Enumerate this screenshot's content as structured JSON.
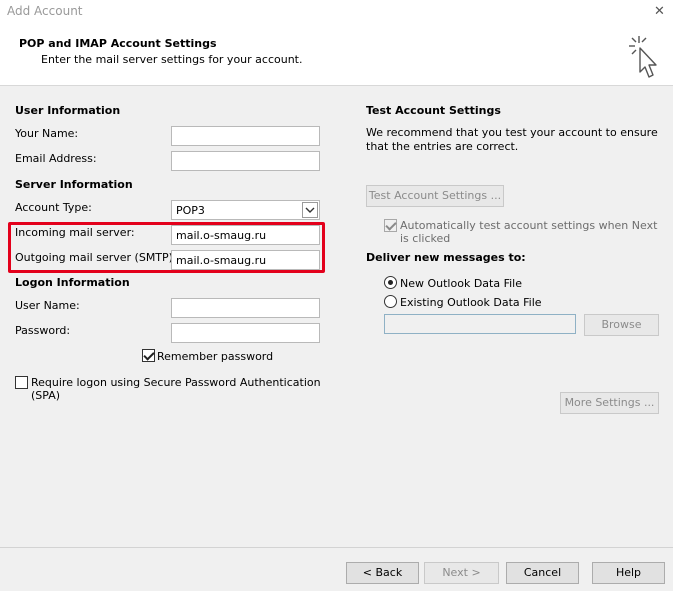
{
  "window": {
    "title": "Add Account",
    "close": "✕"
  },
  "header": {
    "title": "POP and IMAP Account Settings",
    "subtitle": "Enter the mail server settings for your account."
  },
  "user_info": {
    "heading": "User Information",
    "your_name_label": "Your Name:",
    "your_name_value": "",
    "email_label": "Email Address:",
    "email_value": ""
  },
  "server_info": {
    "heading": "Server Information",
    "account_type_label": "Account Type:",
    "account_type_value": "POP3",
    "incoming_label": "Incoming mail server:",
    "incoming_value": "mail.o-smaug.ru",
    "outgoing_label": "Outgoing mail server (SMTP):",
    "outgoing_value": "mail.o-smaug.ru"
  },
  "logon_info": {
    "heading": "Logon Information",
    "username_label": "User Name:",
    "username_value": "",
    "password_label": "Password:",
    "password_value": "",
    "remember_label": "Remember password",
    "remember_checked": true,
    "spa_label": "Require logon using Secure Password Authentication (SPA)",
    "spa_checked": false
  },
  "test_settings": {
    "heading": "Test Account Settings",
    "description": "We recommend that you test your account to ensure that the entries are correct.",
    "test_button": "Test Account Settings ...",
    "auto_test_label": "Automatically test account settings when Next is clicked",
    "auto_test_checked": true
  },
  "deliver": {
    "heading": "Deliver new messages to:",
    "option_new": "New Outlook Data File",
    "option_existing": "Existing Outlook Data File",
    "selected": "new",
    "existing_path": "",
    "browse_button": "Browse"
  },
  "more_settings_button": "More Settings ...",
  "footer": {
    "back": "< Back",
    "next": "Next >",
    "cancel": "Cancel",
    "help": "Help"
  },
  "highlight_color": "#e3001b"
}
